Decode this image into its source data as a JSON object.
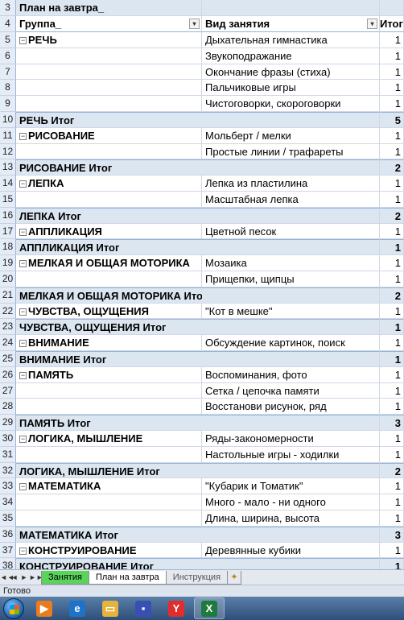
{
  "title_row": {
    "num": "3",
    "label": "План на завтра_"
  },
  "header_row": {
    "num": "4",
    "col_a": "Группа_",
    "col_b": "Вид занятия",
    "col_c": "Итог",
    "col_a_dropdown": "▾",
    "col_b_dropdown": "▾",
    "col_b_filter": "▾"
  },
  "rows": [
    {
      "num": "5",
      "type": "group",
      "a": "РЕЧЬ",
      "b": "Дыхательная гимнастика",
      "c": "1"
    },
    {
      "num": "6",
      "type": "item",
      "a": "",
      "b": "Звукоподражание",
      "c": "1"
    },
    {
      "num": "7",
      "type": "item",
      "a": "",
      "b": "Окончание фразы (стиха)",
      "c": "1"
    },
    {
      "num": "8",
      "type": "item",
      "a": "",
      "b": "Пальчиковые игры",
      "c": "1"
    },
    {
      "num": "9",
      "type": "item",
      "a": "",
      "b": "Чистоговорки, скороговорки",
      "c": "1"
    },
    {
      "num": "10",
      "type": "total",
      "a": "РЕЧЬ Итог",
      "b": "",
      "c": "5"
    },
    {
      "num": "11",
      "type": "group",
      "a": "РИСОВАНИЕ",
      "b": "Мольберт / мелки",
      "c": "1"
    },
    {
      "num": "12",
      "type": "item",
      "a": "",
      "b": "Простые линии / трафареты",
      "c": "1"
    },
    {
      "num": "13",
      "type": "total",
      "a": "РИСОВАНИЕ Итог",
      "b": "",
      "c": "2"
    },
    {
      "num": "14",
      "type": "group",
      "a": "ЛЕПКА",
      "b": "Лепка из пластилина",
      "c": "1"
    },
    {
      "num": "15",
      "type": "item",
      "a": "",
      "b": "Масштабная лепка",
      "c": "1"
    },
    {
      "num": "16",
      "type": "total",
      "a": "ЛЕПКА Итог",
      "b": "",
      "c": "2"
    },
    {
      "num": "17",
      "type": "group",
      "a": "АППЛИКАЦИЯ",
      "b": "Цветной песок",
      "c": "1"
    },
    {
      "num": "18",
      "type": "total",
      "a": "АППЛИКАЦИЯ Итог",
      "b": "",
      "c": "1"
    },
    {
      "num": "19",
      "type": "group",
      "a": "МЕЛКАЯ И ОБЩАЯ МОТОРИКА",
      "b": "Мозаика",
      "c": "1"
    },
    {
      "num": "20",
      "type": "item",
      "a": "",
      "b": "Прищепки, щипцы",
      "c": "1"
    },
    {
      "num": "21",
      "type": "total",
      "a": "МЕЛКАЯ И ОБЩАЯ МОТОРИКА Итог",
      "b": "",
      "c": "2"
    },
    {
      "num": "22",
      "type": "group",
      "a": "ЧУВСТВА, ОЩУЩЕНИЯ",
      "b": "\"Кот в мешке\"",
      "c": "1"
    },
    {
      "num": "23",
      "type": "total",
      "a": "ЧУВСТВА, ОЩУЩЕНИЯ Итог",
      "b": "",
      "c": "1"
    },
    {
      "num": "24",
      "type": "group",
      "a": "ВНИМАНИЕ",
      "b": "Обсуждение картинок, поиск",
      "c": "1"
    },
    {
      "num": "25",
      "type": "total",
      "a": "ВНИМАНИЕ Итог",
      "b": "",
      "c": "1"
    },
    {
      "num": "26",
      "type": "group",
      "a": "ПАМЯТЬ",
      "b": "Воспоминания, фото",
      "c": "1"
    },
    {
      "num": "27",
      "type": "item",
      "a": "",
      "b": "Сетка / цепочка памяти",
      "c": "1"
    },
    {
      "num": "28",
      "type": "item",
      "a": "",
      "b": "Восстанови рисунок, ряд",
      "c": "1"
    },
    {
      "num": "29",
      "type": "total",
      "a": "ПАМЯТЬ Итог",
      "b": "",
      "c": "3"
    },
    {
      "num": "30",
      "type": "group",
      "a": "ЛОГИКА, МЫШЛЕНИЕ",
      "b": "Ряды-закономерности",
      "c": "1"
    },
    {
      "num": "31",
      "type": "item",
      "a": "",
      "b": "Настольные игры - ходилки",
      "c": "1"
    },
    {
      "num": "32",
      "type": "total",
      "a": "ЛОГИКА, МЫШЛЕНИЕ Итог",
      "b": "",
      "c": "2"
    },
    {
      "num": "33",
      "type": "group",
      "a": "МАТЕМАТИКА",
      "b": "\"Кубарик и Томатик\"",
      "c": "1"
    },
    {
      "num": "34",
      "type": "item",
      "a": "",
      "b": "Много - мало - ни одного",
      "c": "1"
    },
    {
      "num": "35",
      "type": "item",
      "a": "",
      "b": "Длина, ширина, высота",
      "c": "1"
    },
    {
      "num": "36",
      "type": "total",
      "a": "МАТЕМАТИКА Итог",
      "b": "",
      "c": "3"
    },
    {
      "num": "37",
      "type": "group",
      "a": "КОНСТРУИРОВАНИЕ",
      "b": "Деревянные кубики",
      "c": "1"
    },
    {
      "num": "38",
      "type": "total",
      "a": "КОНСТРУИРОВАНИЕ Итог",
      "b": "",
      "c": "1"
    }
  ],
  "collapse_symbol": "⊟",
  "sheet_tabs": {
    "nav": [
      "◄◄",
      "◄",
      "►",
      "►►"
    ],
    "tabs": [
      {
        "label": "Занятия",
        "style": "green"
      },
      {
        "label": "План на завтра",
        "style": "active"
      },
      {
        "label": "Инструкция",
        "style": "plain"
      }
    ]
  },
  "status_text": "Готово",
  "taskbar": {
    "items": [
      {
        "name": "start-orb-icon",
        "glyph": ""
      },
      {
        "name": "media-player-icon",
        "glyph": "▶",
        "color": "#e87c1e"
      },
      {
        "name": "ie-browser-icon",
        "glyph": "e",
        "color": "#1e73c8"
      },
      {
        "name": "explorer-folder-icon",
        "glyph": "▭",
        "color": "#e6b43c"
      },
      {
        "name": "save-disk-icon",
        "glyph": "▪",
        "color": "#3a4fb3"
      },
      {
        "name": "yandex-browser-icon",
        "glyph": "Y",
        "color": "#e22d2d"
      },
      {
        "name": "excel-icon",
        "glyph": "X",
        "color": "#1f7a3d"
      }
    ]
  }
}
